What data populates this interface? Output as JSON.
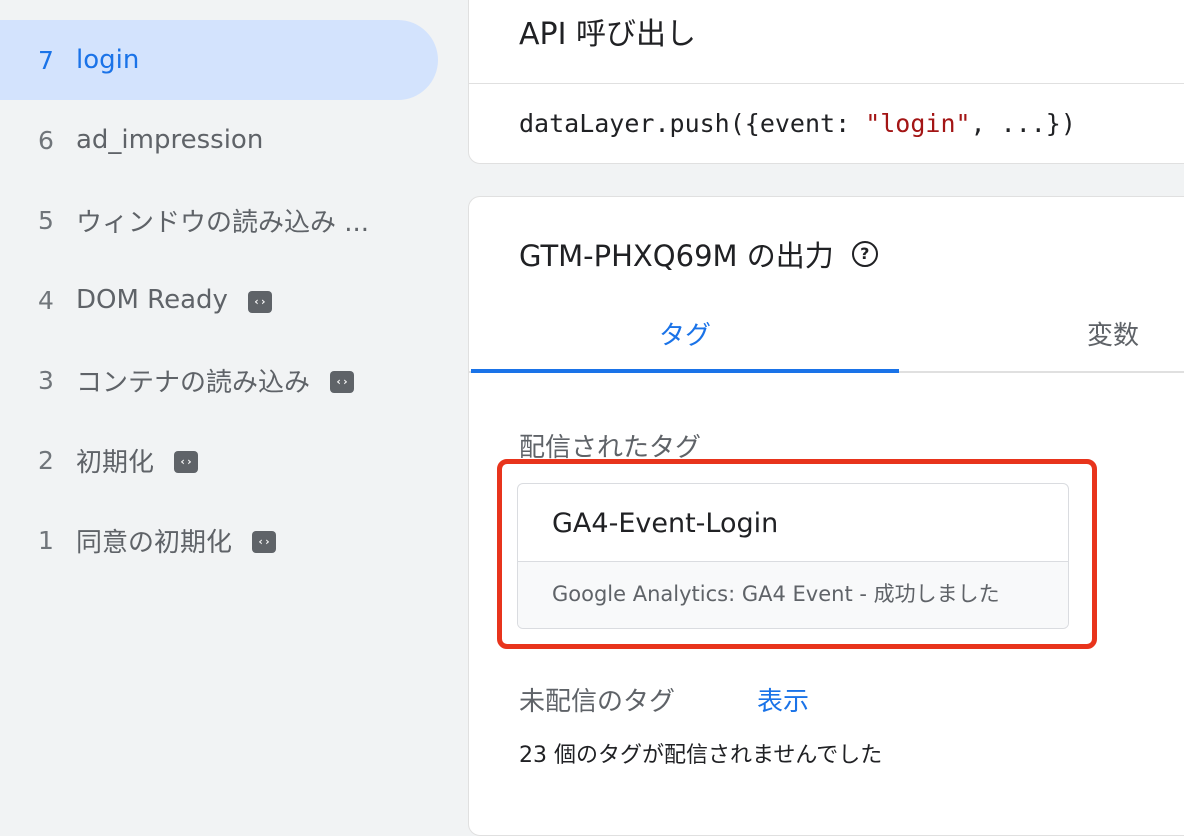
{
  "sidebar": {
    "items": [
      {
        "num": "7",
        "label": "login"
      },
      {
        "num": "6",
        "label": "ad_impression"
      },
      {
        "num": "5",
        "label": "ウィンドウの読み込み ..."
      },
      {
        "num": "4",
        "label": "DOM Ready",
        "icon": "code-icon"
      },
      {
        "num": "3",
        "label": "コンテナの読み込み",
        "icon": "code-icon"
      },
      {
        "num": "2",
        "label": "初期化",
        "icon": "code-icon"
      },
      {
        "num": "1",
        "label": "同意の初期化",
        "icon": "code-icon"
      }
    ]
  },
  "api_card": {
    "title": "API 呼び出し",
    "code_prefix": "dataLayer.push({event: ",
    "code_string": "\"login\"",
    "code_suffix": ", ...})"
  },
  "output_card": {
    "title": "GTM-PHXQ69M の出力",
    "tabs": {
      "tags": "タグ",
      "variables": "変数"
    },
    "fired_label": "配信されたタグ",
    "fired_tag": {
      "name": "GA4-Event-Login",
      "status": "Google Analytics: GA4 Event - 成功しました"
    },
    "unfired_label": "未配信のタグ",
    "show_link": "表示",
    "unfired_count": "23 個のタグが配信されませんでした"
  },
  "colors": {
    "accent": "#1a73e8",
    "highlight": "#e8341c",
    "active_bg": "#d3e3fd"
  }
}
